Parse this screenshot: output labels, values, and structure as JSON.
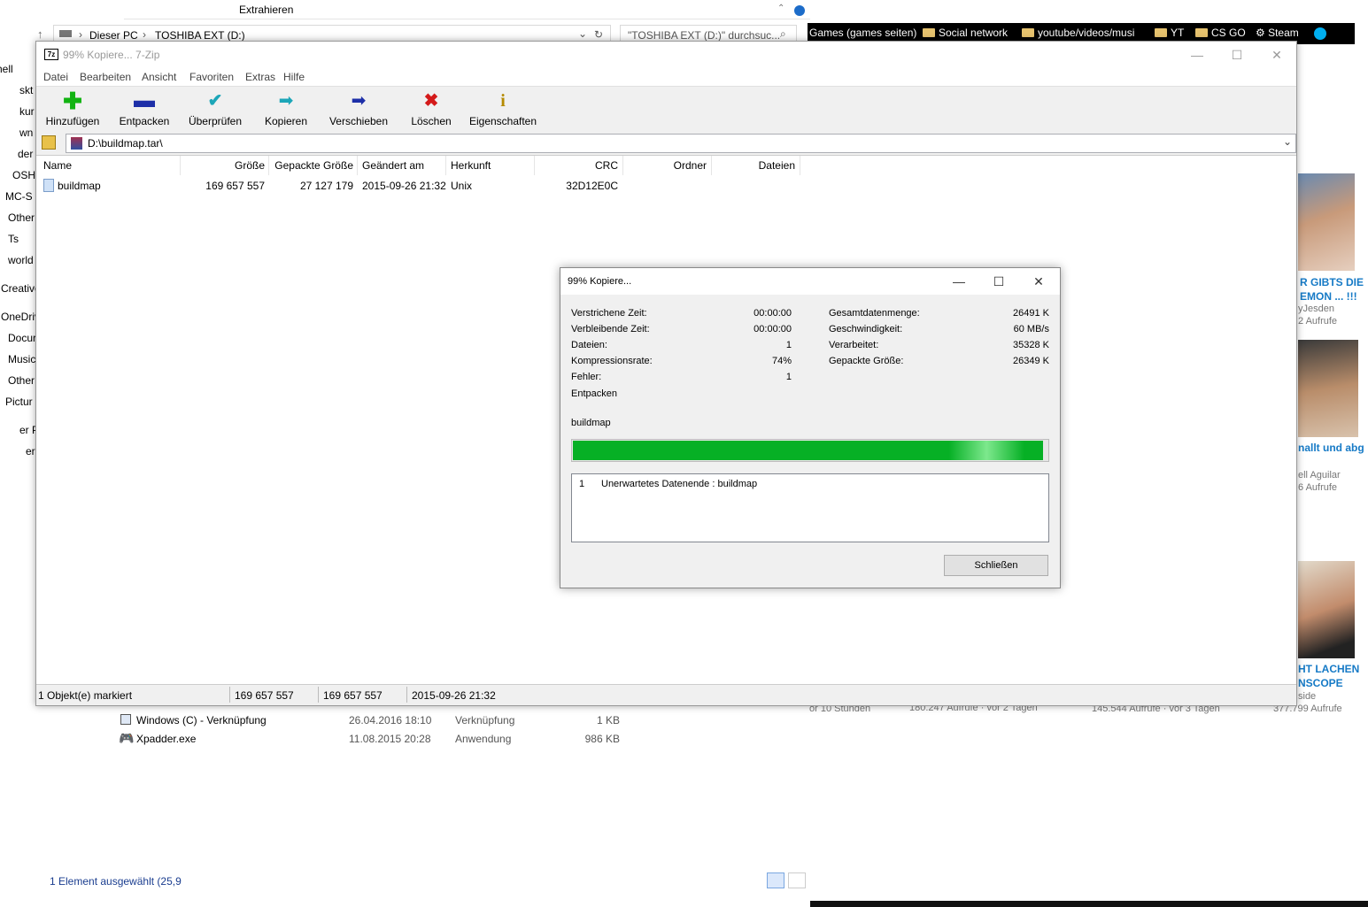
{
  "explorer": {
    "ribbon_tab": "Extrahieren",
    "crumb_1": "Dieser PC",
    "crumb_2": "TOSHIBA EXT (D:)",
    "search_placeholder": "\"TOSHIBA EXT (D:)\" durchsuc...",
    "left_nav": [
      "hell",
      "skt",
      "kur",
      "wn",
      "der",
      "OSH",
      "MC-S",
      "Other",
      "Ts",
      "world",
      "Creative",
      "OneDriv",
      "Docur",
      "Music",
      "Other",
      "Pictur",
      "er P",
      "er"
    ],
    "files": [
      {
        "name": "Windows (C) - Verknüpfung",
        "date": "26.04.2016 18:10",
        "type": "Verknüpfung",
        "size": "1 KB"
      },
      {
        "name": "Xpadder.exe",
        "date": "11.08.2015 20:28",
        "type": "Anwendung",
        "size": "986 KB"
      }
    ],
    "status": "1 Element ausgewählt (25,9 "
  },
  "browser": {
    "bookmarks": [
      "Games (games seiten)",
      "Social network",
      "youtube/videos/musi",
      "YT",
      "CS GO",
      "Steam"
    ],
    "videos": [
      {
        "title1": "R GIBTS DIE",
        "title2": "EMON ... !!!",
        "channel": "yJesden",
        "views": "2 Aufrufe"
      },
      {
        "title1": "nallt und abg",
        "channel": "ell Aguilar",
        "views": "6 Aufrufe"
      },
      {
        "title1": "HT LACHEN",
        "title2": "NSCOPE",
        "channel": "side",
        "views": "377.799 Aufrufe"
      }
    ],
    "bottom_views": [
      "or 10 Stunden",
      "180.247 Aufrufe · vor 2 Tagen",
      "145.544 Aufrufe · vor 3 Tagen"
    ]
  },
  "zip": {
    "title": "99% Kopiere... 7-Zip",
    "menu": [
      "Datei",
      "Bearbeiten",
      "Ansicht",
      "Favoriten",
      "Extras",
      "Hilfe"
    ],
    "toolbar": [
      "Hinzufügen",
      "Entpacken",
      "Überprüfen",
      "Kopieren",
      "Verschieben",
      "Löschen",
      "Eigenschaften"
    ],
    "path": "D:\\buildmap.tar\\",
    "columns": [
      "Name",
      "Größe",
      "Gepackte Größe",
      "Geändert am",
      "Herkunft",
      "CRC",
      "Ordner",
      "Dateien"
    ],
    "row": {
      "name": "buildmap",
      "size": "169 657 557",
      "packed": "27 127 179",
      "modified": "2015-09-26 21:32",
      "origin": "Unix",
      "crc": "32D12E0C"
    },
    "status": [
      "1 Objekt(e) markiert",
      "169 657 557",
      "169 657 557",
      "2015-09-26 21:32"
    ]
  },
  "dialog": {
    "title": "99% Kopiere...",
    "left_labels": [
      "Verstrichene Zeit:",
      "Verbleibende Zeit:",
      "Dateien:",
      "Kompressionsrate:",
      "Fehler:"
    ],
    "left_values": [
      "00:00:00",
      "00:00:00",
      "1",
      "74%",
      "1"
    ],
    "right_labels": [
      "Gesamtdatenmenge:",
      "Geschwindigkeit:",
      "Verarbeitet:",
      "Gepackte Größe:"
    ],
    "right_values": [
      "26491 K",
      "60 MB/s",
      "35328 K",
      "26349 K"
    ],
    "operation": "Entpacken",
    "current_file": "buildmap",
    "progress_fraction": 0.99,
    "error_index": "1",
    "error_text": "Unerwartetes Datenende : buildmap",
    "close_label": "Schließen"
  }
}
